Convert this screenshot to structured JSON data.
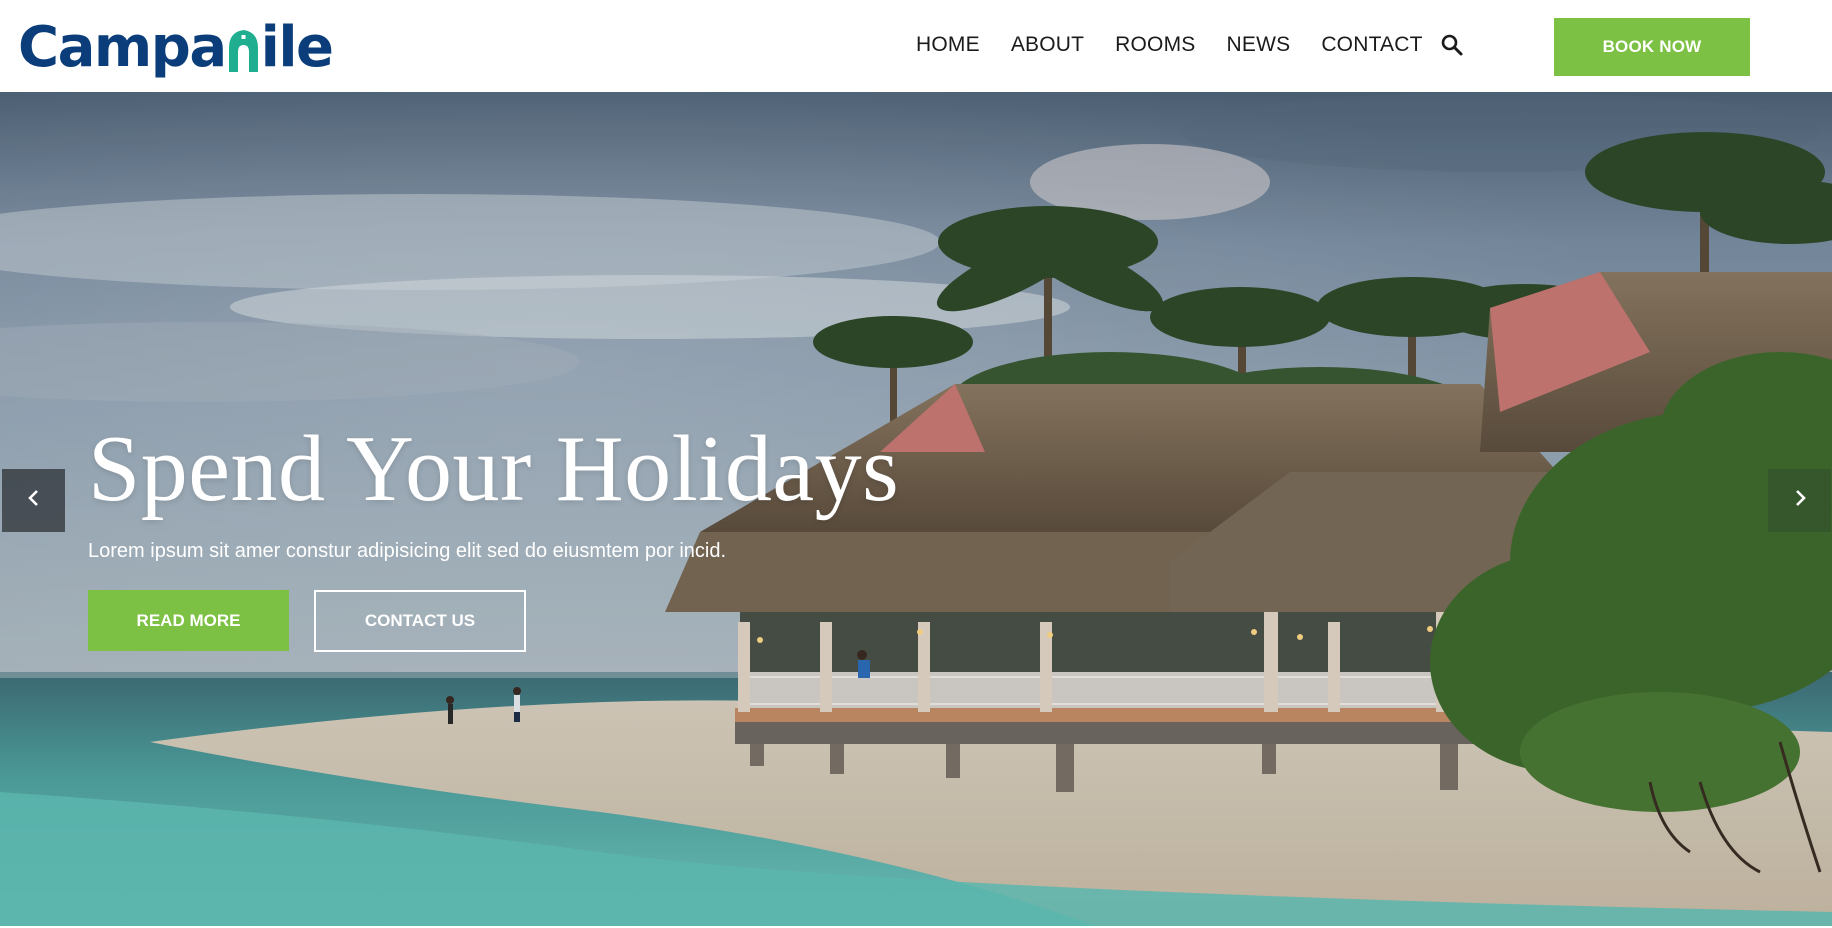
{
  "brand": {
    "name_part1": "Campa",
    "name_part2": "ile",
    "primary_color": "#0a3d7a",
    "accent_color": "#1fae8f"
  },
  "nav": {
    "items": [
      {
        "label": "HOME"
      },
      {
        "label": "ABOUT"
      },
      {
        "label": "ROOMS"
      },
      {
        "label": "NEWS"
      },
      {
        "label": "CONTACT"
      }
    ],
    "search_icon": "search-icon",
    "book_label": "BOOK NOW",
    "book_color": "#7cc044"
  },
  "hero": {
    "title": "Spend Your Holidays",
    "subtitle": "Lorem ipsum sit amer constur adipisicing elit sed do eiusmtem por incid.",
    "primary_button": "READ MORE",
    "secondary_button": "CONTACT US",
    "prev_icon": "chevron-left-icon",
    "next_icon": "chevron-right-icon"
  }
}
